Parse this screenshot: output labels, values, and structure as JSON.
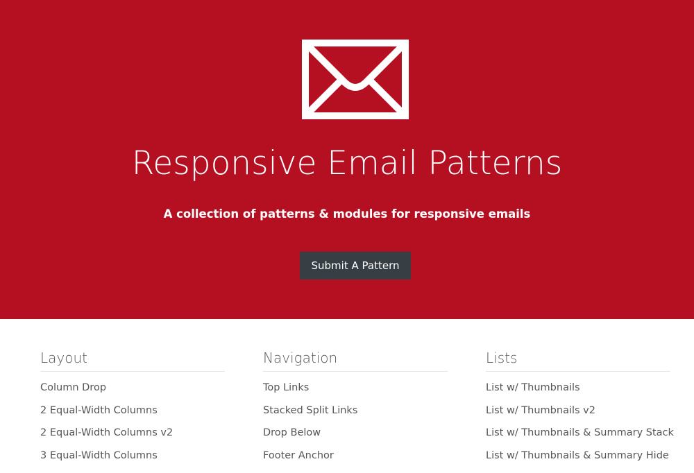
{
  "hero": {
    "icon": "envelope-icon",
    "title": "Responsive Email Patterns",
    "subtitle": "A collection of patterns & modules for responsive emails",
    "button_label": "Submit A Pattern",
    "background_color": "#b50f22",
    "button_color": "#373f44"
  },
  "sections": [
    {
      "heading": "Layout",
      "items": [
        "Column Drop",
        "2 Equal-Width Columns",
        "2 Equal-Width Columns v2",
        "3 Equal-Width Columns"
      ]
    },
    {
      "heading": "Navigation",
      "items": [
        "Top Links",
        "Stacked Split Links",
        "Drop Below",
        "Footer Anchor"
      ]
    },
    {
      "heading": "Lists",
      "items": [
        "List w/ Thumbnails",
        "List w/ Thumbnails v2",
        "List w/ Thumbnails & Summary Stack",
        "List w/ Thumbnails & Summary Hide"
      ]
    }
  ]
}
